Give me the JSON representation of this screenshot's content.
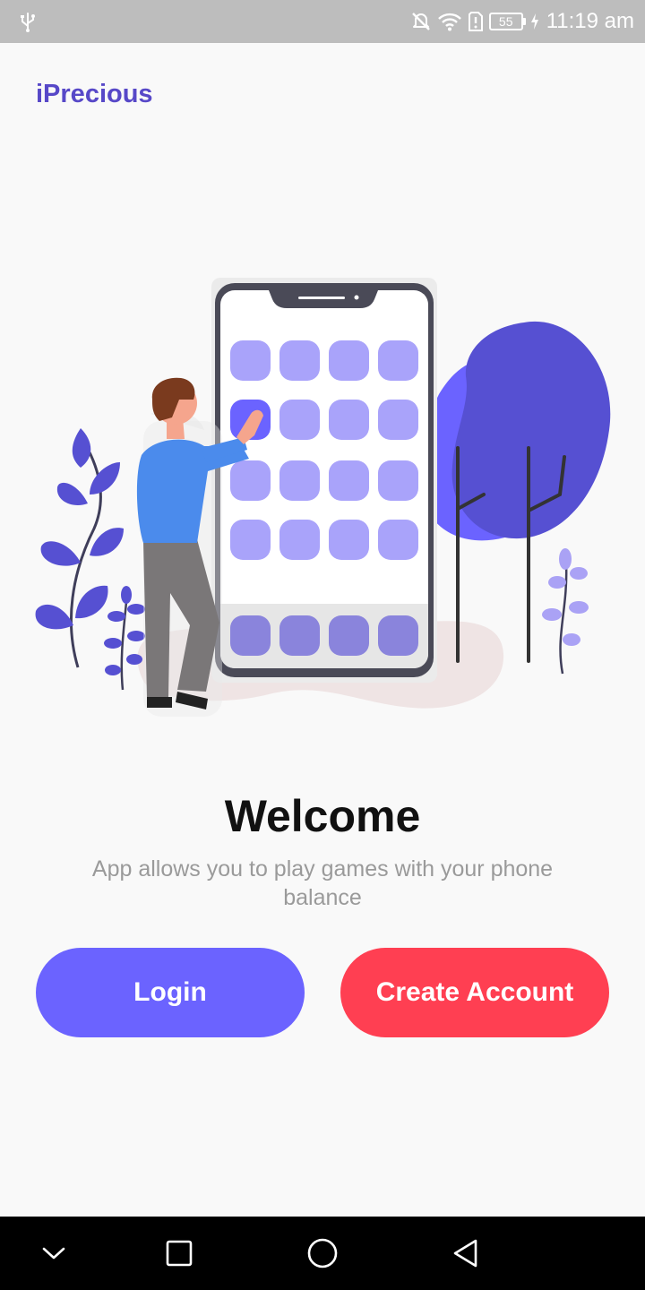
{
  "status_bar": {
    "battery_level": "55",
    "time": "11:19 am",
    "icons": [
      "usb-icon",
      "mute-icon",
      "wifi-icon",
      "sim-alert-icon",
      "battery-icon",
      "charging-icon"
    ]
  },
  "app": {
    "title": "iPrecious"
  },
  "welcome": {
    "title": "Welcome",
    "subtitle": "App allows you to play games with your phone balance"
  },
  "actions": {
    "login_label": "Login",
    "create_account_label": "Create Account"
  },
  "nav_bar": {
    "icons": [
      "chevron-down-icon",
      "square-icon",
      "circle-icon",
      "back-triangle-icon"
    ]
  },
  "colors": {
    "brand": "#5748c8",
    "login": "#6b63ff",
    "create_account": "#ff3f52",
    "status_bar": "#bdbdbd",
    "background": "#f9f9f9"
  }
}
